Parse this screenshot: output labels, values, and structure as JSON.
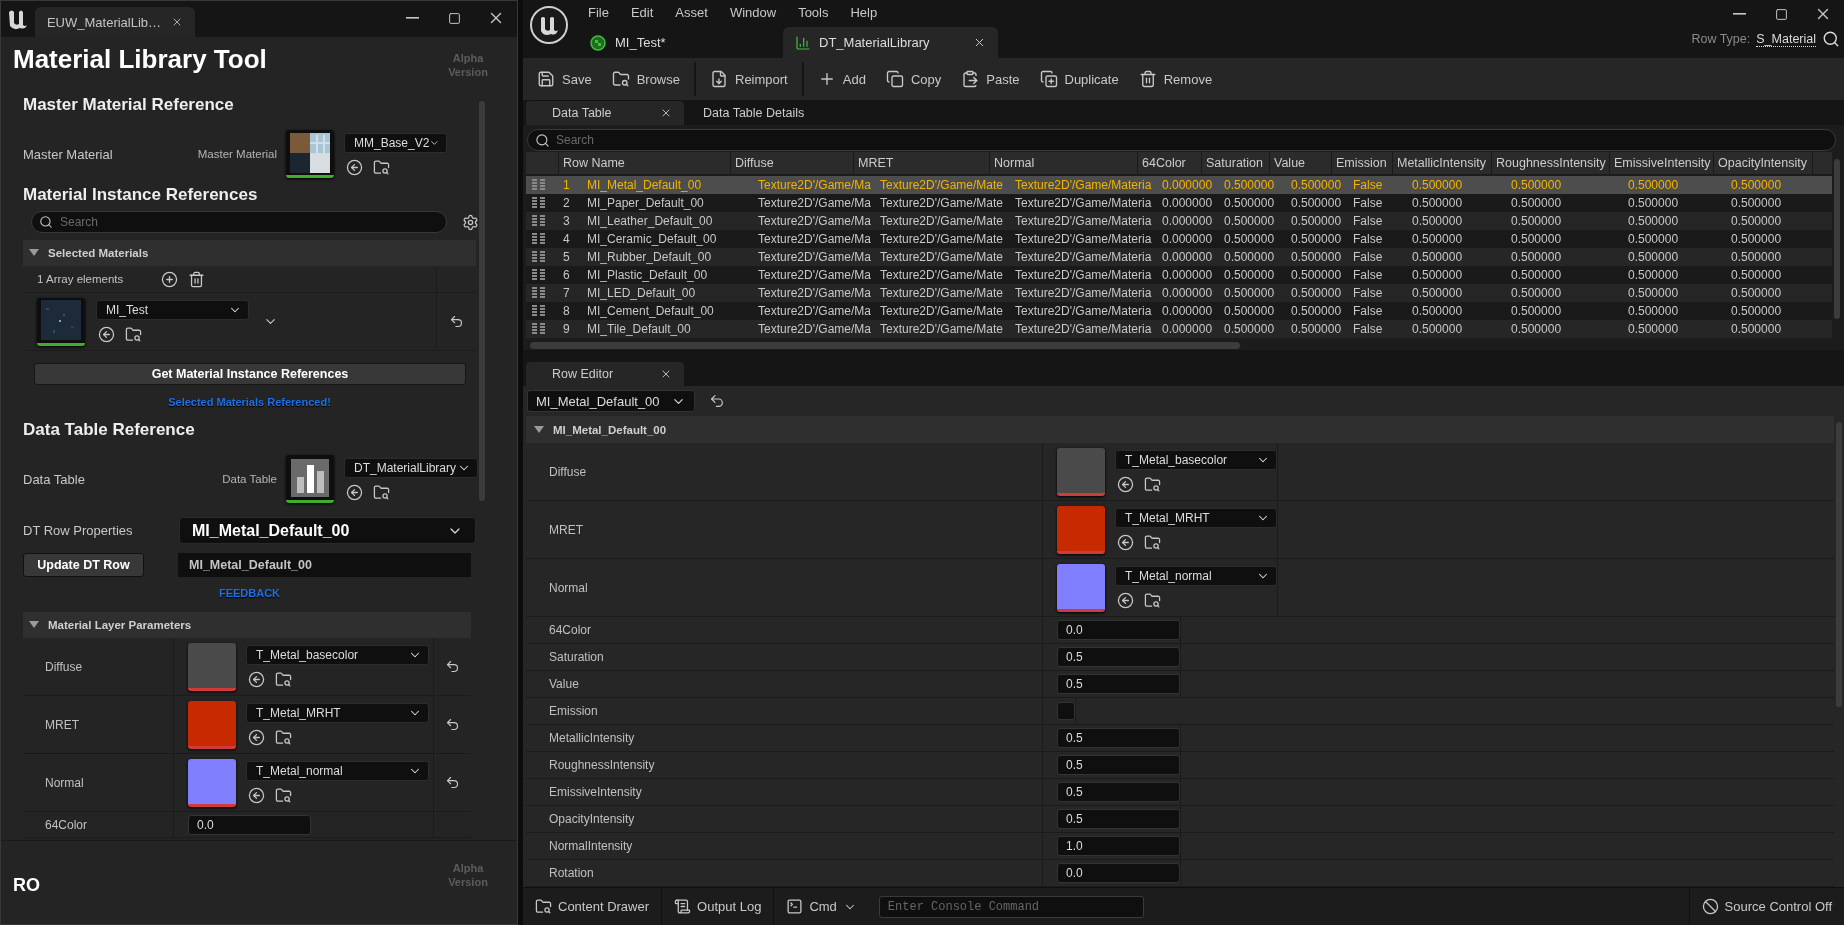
{
  "left_window": {
    "tab": "EUW_MaterialLib…",
    "title": "Material Library Tool",
    "version_badge": "Alpha Version",
    "master": {
      "heading": "Master Material Reference",
      "label": "Master Material",
      "sub_label": "Master Material",
      "asset": "MM_Base_V2"
    },
    "instances": {
      "heading": "Material Instance References",
      "search_placeholder": "Search",
      "array": {
        "title": "Selected Materials",
        "expanded": true,
        "count": "1 Array elements",
        "elements": [
          {
            "asset": "MI_Test"
          }
        ]
      },
      "button": "Get Material Instance References",
      "status": "Selected Materials Referenced!"
    },
    "data_table": {
      "heading": "Data Table Reference",
      "label": "Data Table",
      "sub_label": "Data Table",
      "asset": "DT_MaterialLibrary"
    },
    "row_properties": {
      "label": "DT Row Properties",
      "value": "MI_Metal_Default_00"
    },
    "update": {
      "button": "Update DT Row",
      "value": "MI_Metal_Default_00"
    },
    "feedback": "FEEDBACK",
    "layer_params": {
      "title": "Material Layer Parameters",
      "expanded": true,
      "rows": [
        {
          "kind": "texture",
          "label": "Diffuse",
          "asset": "T_Metal_basecolor",
          "color": "#4a4a4a"
        },
        {
          "kind": "texture",
          "label": "MRET",
          "asset": "T_Metal_MRHT",
          "color": "#c82a00"
        },
        {
          "kind": "texture",
          "label": "Normal",
          "asset": "T_Metal_normal",
          "color": "#8080ff"
        },
        {
          "kind": "number",
          "label": "64Color",
          "value": "0.0"
        }
      ]
    },
    "footer": {
      "label": "RO",
      "version_badge": "Alpha Version"
    }
  },
  "editor": {
    "menu": [
      "File",
      "Edit",
      "Asset",
      "Window",
      "Tools",
      "Help"
    ],
    "doc_tabs": [
      {
        "label": "MI_Test*",
        "selected": false
      },
      {
        "label": "DT_MaterialLibrary",
        "selected": true
      }
    ],
    "row_type": {
      "label": "Row Type:",
      "value": "S_Material"
    },
    "toolbar": [
      [
        "Save",
        "Browse"
      ],
      [
        "Reimport"
      ],
      [
        "Add",
        "Copy",
        "Paste",
        "Duplicate",
        "Remove"
      ]
    ],
    "panel_tabs": [
      {
        "label": "Data Table",
        "selected": true
      },
      {
        "label": "Data Table Details",
        "selected": false
      }
    ],
    "search_placeholder": "Search",
    "table": {
      "columns": [
        "Row Name",
        "Diffuse",
        "MRET",
        "Normal",
        "64Color",
        "Saturation",
        "Value",
        "Emission",
        "MetallicIntensity",
        "RoughnessIntensity",
        "EmissiveIntensity",
        "OpacityIntensity"
      ],
      "rows": [
        {
          "index": "1",
          "selected": true,
          "cells": [
            "MI_Metal_Default_00",
            "Texture2D'/Game/Ma",
            "Texture2D'/Game/Mate",
            "Texture2D'/Game/Materia",
            "0.000000",
            "0.500000",
            "0.500000",
            "False",
            "0.500000",
            "0.500000",
            "0.500000",
            "0.500000"
          ]
        },
        {
          "index": "2",
          "selected": false,
          "cells": [
            "MI_Paper_Default_00",
            "Texture2D'/Game/Ma",
            "Texture2D'/Game/Mate",
            "Texture2D'/Game/Materia",
            "0.000000",
            "0.500000",
            "0.500000",
            "False",
            "0.500000",
            "0.500000",
            "0.500000",
            "0.500000"
          ]
        },
        {
          "index": "3",
          "selected": false,
          "cells": [
            "MI_Leather_Default_00",
            "Texture2D'/Game/Ma",
            "Texture2D'/Game/Mate",
            "Texture2D'/Game/Materia",
            "0.000000",
            "0.500000",
            "0.500000",
            "False",
            "0.500000",
            "0.500000",
            "0.500000",
            "0.500000"
          ]
        },
        {
          "index": "4",
          "selected": false,
          "cells": [
            "MI_Ceramic_Default_00",
            "Texture2D'/Game/Ma",
            "Texture2D'/Game/Mate",
            "Texture2D'/Game/Materia",
            "0.000000",
            "0.500000",
            "0.500000",
            "False",
            "0.500000",
            "0.500000",
            "0.500000",
            "0.500000"
          ]
        },
        {
          "index": "5",
          "selected": false,
          "cells": [
            "MI_Rubber_Default_00",
            "Texture2D'/Game/Ma",
            "Texture2D'/Game/Mate",
            "Texture2D'/Game/Materia",
            "0.000000",
            "0.500000",
            "0.500000",
            "False",
            "0.500000",
            "0.500000",
            "0.500000",
            "0.500000"
          ]
        },
        {
          "index": "6",
          "selected": false,
          "cells": [
            "MI_Plastic_Default_00",
            "Texture2D'/Game/Ma",
            "Texture2D'/Game/Mate",
            "Texture2D'/Game/Materia",
            "0.000000",
            "0.500000",
            "0.500000",
            "False",
            "0.500000",
            "0.500000",
            "0.500000",
            "0.500000"
          ]
        },
        {
          "index": "7",
          "selected": false,
          "cells": [
            "MI_LED_Default_00",
            "Texture2D'/Game/Ma",
            "Texture2D'/Game/Mate",
            "Texture2D'/Game/Materia",
            "0.000000",
            "0.500000",
            "0.500000",
            "False",
            "0.500000",
            "0.500000",
            "0.500000",
            "0.500000"
          ]
        },
        {
          "index": "8",
          "selected": false,
          "cells": [
            "MI_Cement_Default_00",
            "Texture2D'/Game/Ma",
            "Texture2D'/Game/Mate",
            "Texture2D'/Game/Materia",
            "0.000000",
            "0.500000",
            "0.500000",
            "False",
            "0.500000",
            "0.500000",
            "0.500000",
            "0.500000"
          ]
        },
        {
          "index": "9",
          "selected": false,
          "cells": [
            "MI_Tile_Default_00",
            "Texture2D'/Game/Ma",
            "Texture2D'/Game/Mate",
            "Texture2D'/Game/Materia",
            "0.000000",
            "0.500000",
            "0.500000",
            "False",
            "0.500000",
            "0.500000",
            "0.500000",
            "0.500000"
          ]
        }
      ]
    },
    "row_editor": {
      "tab": "Row Editor",
      "row": "MI_Metal_Default_00",
      "section": "MI_Metal_Default_00",
      "expanded": true,
      "properties": [
        {
          "kind": "texture",
          "label": "Diffuse",
          "asset": "T_Metal_basecolor",
          "color": "#4a4a4a"
        },
        {
          "kind": "texture",
          "label": "MRET",
          "asset": "T_Metal_MRHT",
          "color": "#c82a00"
        },
        {
          "kind": "texture",
          "label": "Normal",
          "asset": "T_Metal_normal",
          "color": "#8080ff"
        },
        {
          "kind": "number",
          "label": "64Color",
          "value": "0.0"
        },
        {
          "kind": "number",
          "label": "Saturation",
          "value": "0.5"
        },
        {
          "kind": "number",
          "label": "Value",
          "value": "0.5"
        },
        {
          "kind": "checkbox",
          "label": "Emission",
          "checked": false
        },
        {
          "kind": "number",
          "label": "MetallicIntensity",
          "value": "0.5"
        },
        {
          "kind": "number",
          "label": "RoughnessIntensity",
          "value": "0.5"
        },
        {
          "kind": "number",
          "label": "EmissiveIntensity",
          "value": "0.5"
        },
        {
          "kind": "number",
          "label": "OpacityIntensity",
          "value": "0.5"
        },
        {
          "kind": "number",
          "label": "NormalIntensity",
          "value": "1.0"
        },
        {
          "kind": "number",
          "label": "Rotation",
          "value": "0.0"
        }
      ]
    },
    "status_bar": {
      "content_drawer": "Content Drawer",
      "output_log": "Output Log",
      "cmd": "Cmd",
      "console_placeholder": "Enter Console Command",
      "source_control": "Source Control Off"
    }
  }
}
